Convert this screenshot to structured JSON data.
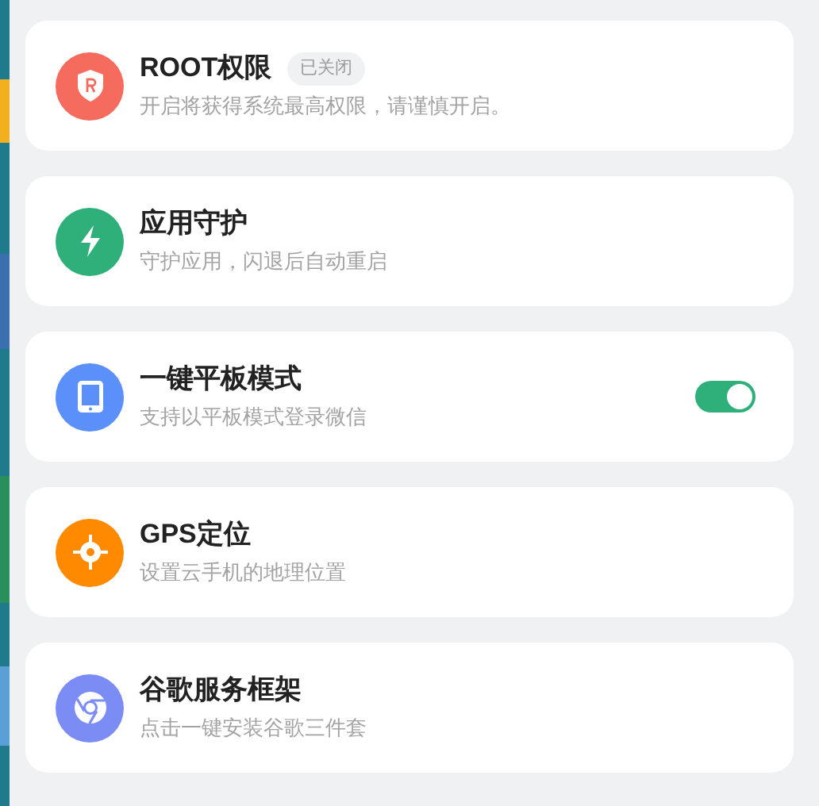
{
  "settings": [
    {
      "kind": "badge",
      "title": "ROOT权限",
      "badge": "已关闭",
      "subtitle": "开启将获得系统最高权限，请谨慎开启。",
      "color": "#f56c5f"
    },
    {
      "kind": "plain",
      "title": "应用守护",
      "subtitle": "守护应用，闪退后自动重启",
      "color": "#2fb07a"
    },
    {
      "kind": "toggle",
      "title": "一键平板模式",
      "subtitle": "支持以平板模式登录微信",
      "color": "#5b8ff9",
      "on": true
    },
    {
      "kind": "plain",
      "title": "GPS定位",
      "subtitle": "设置云手机的地理位置",
      "color": "#ff8a00"
    },
    {
      "kind": "plain",
      "title": "谷歌服务框架",
      "subtitle": "点击一键安装谷歌三件套",
      "color": "#7b8cf5"
    }
  ]
}
